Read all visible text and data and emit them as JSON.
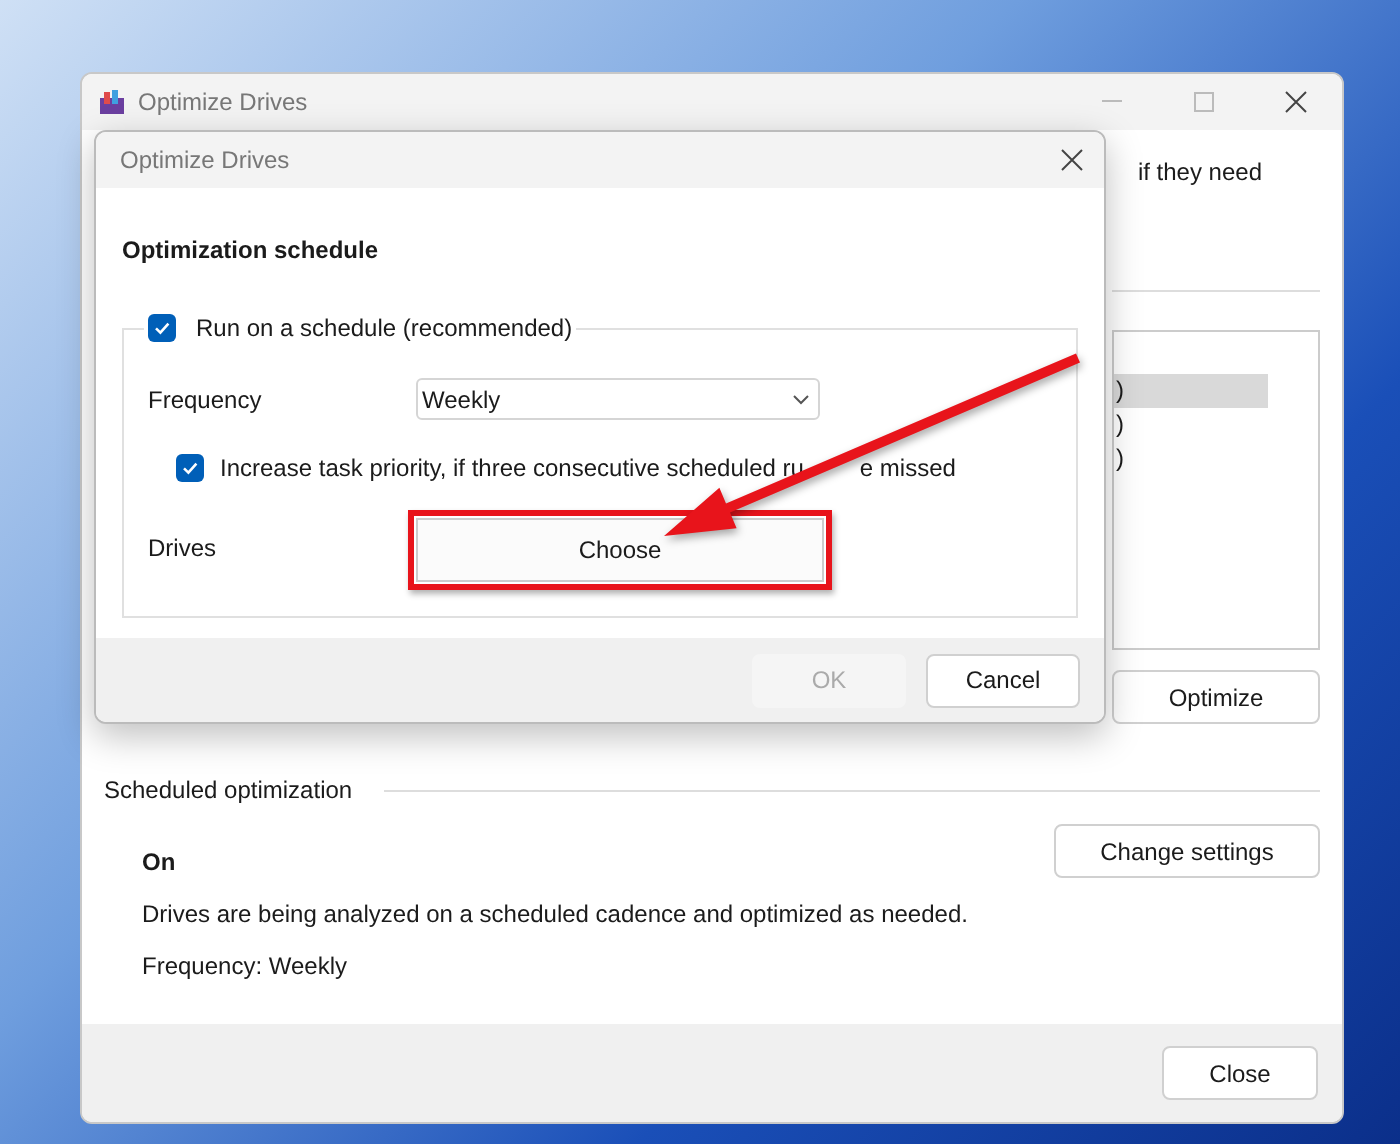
{
  "main_window": {
    "title": "Optimize Drives",
    "partial_text": "if they need",
    "list_rows": [
      {
        "text": ")",
        "selected": true
      },
      {
        "text": ")",
        "selected": false
      },
      {
        "text": ")",
        "selected": false
      }
    ],
    "optimize_button": "Optimize",
    "scheduled_section": {
      "heading": "Scheduled optimization",
      "status": "On",
      "description": "Drives are being analyzed on a scheduled cadence and optimized as needed.",
      "frequency": "Frequency: Weekly",
      "change_button": "Change settings"
    },
    "close_button": "Close"
  },
  "dialog": {
    "title": "Optimize Drives",
    "heading": "Optimization schedule",
    "run_on_schedule": {
      "label": "Run on a schedule (recommended)",
      "checked": true
    },
    "frequency": {
      "label": "Frequency",
      "value": "Weekly"
    },
    "increase_priority": {
      "label_parts": [
        "Increase task priority, if three consecutive scheduled ru",
        "e missed"
      ],
      "checked": true
    },
    "drives": {
      "label": "Drives",
      "button": "Choose"
    },
    "buttons": [
      {
        "label": "OK",
        "disabled": true
      },
      {
        "label": "Cancel",
        "disabled": false
      }
    ]
  }
}
